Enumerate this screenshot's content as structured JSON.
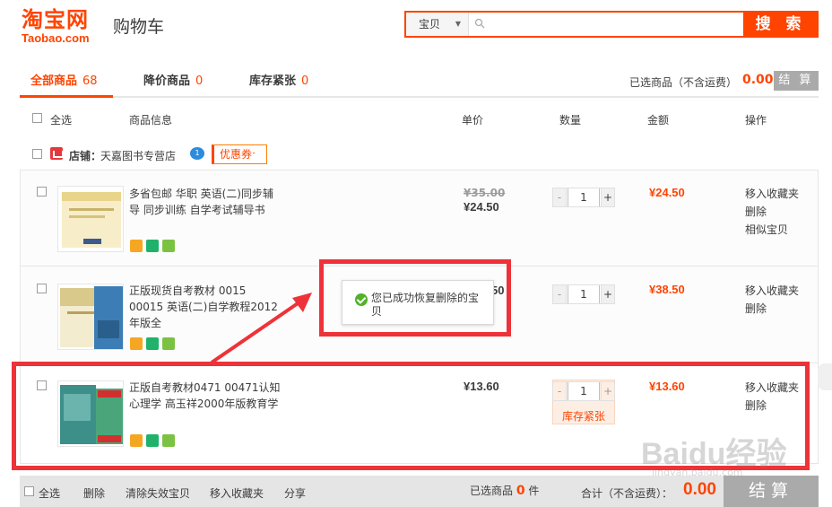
{
  "header": {
    "logo_main": "淘宝网",
    "logo_sub": "Taobao.com",
    "page_title": "购物车",
    "search": {
      "scope": "宝贝",
      "placeholder": "",
      "button_label": "搜 索"
    }
  },
  "tabs": [
    {
      "label": "全部商品",
      "count": "68",
      "active": true
    },
    {
      "label": "降价商品",
      "count": "0",
      "active": false
    },
    {
      "label": "库存紧张",
      "count": "0",
      "active": false
    }
  ],
  "summary": {
    "selected_label": "已选商品（不含运费）",
    "selected_amount": "0.00",
    "checkout_label": "结 算"
  },
  "columns": {
    "select_all": "全选",
    "info": "商品信息",
    "unit_price": "单价",
    "quantity": "数量",
    "amount": "金额",
    "actions": "操作"
  },
  "shop": {
    "label": "店铺：",
    "name": "天嘉图书专营店",
    "coupon": "优惠券"
  },
  "items": [
    {
      "title": "多省包邮 华职 英语(二)同步辅导 同步训练 自学考试辅导书",
      "price_old": "¥35.00",
      "price_now": "¥24.50",
      "quantity": "1",
      "subtotal": "¥24.50",
      "actions": [
        "移入收藏夹",
        "删除",
        "相似宝贝"
      ]
    },
    {
      "title": "正版现货自考教材 0015 00015 英语(二)自学教程2012年版全",
      "price_now": "¥38.50",
      "price_visible": "50",
      "quantity": "1",
      "subtotal": "¥38.50",
      "actions": [
        "移入收藏夹",
        "删除"
      ]
    },
    {
      "title": "正版自考教材0471 00471认知心理学 高玉祥2000年版教育学",
      "price_now": "¥13.60",
      "quantity": "1",
      "subtotal": "¥13.60",
      "stock_label": "库存紧张",
      "actions": [
        "移入收藏夹",
        "删除"
      ]
    }
  ],
  "toast": {
    "message": "您已成功恢复删除的宝贝"
  },
  "footer": {
    "select_all": "全选",
    "delete": "删除",
    "clear_invalid": "清除失效宝贝",
    "move_to_favorites": "移入收藏夹",
    "share": "分享",
    "selected_prefix": "已选商品",
    "selected_count": "0",
    "selected_suffix": "件",
    "total_label": "合计（不含运费）：",
    "total_amount": "0.00",
    "checkout": "结算"
  },
  "watermark": {
    "text": "Baidu经验",
    "sub": "jingyan.baidu.com"
  },
  "colors": {
    "brand": "#ff4400",
    "annotation": "#ee3239",
    "success": "#53b02b"
  }
}
